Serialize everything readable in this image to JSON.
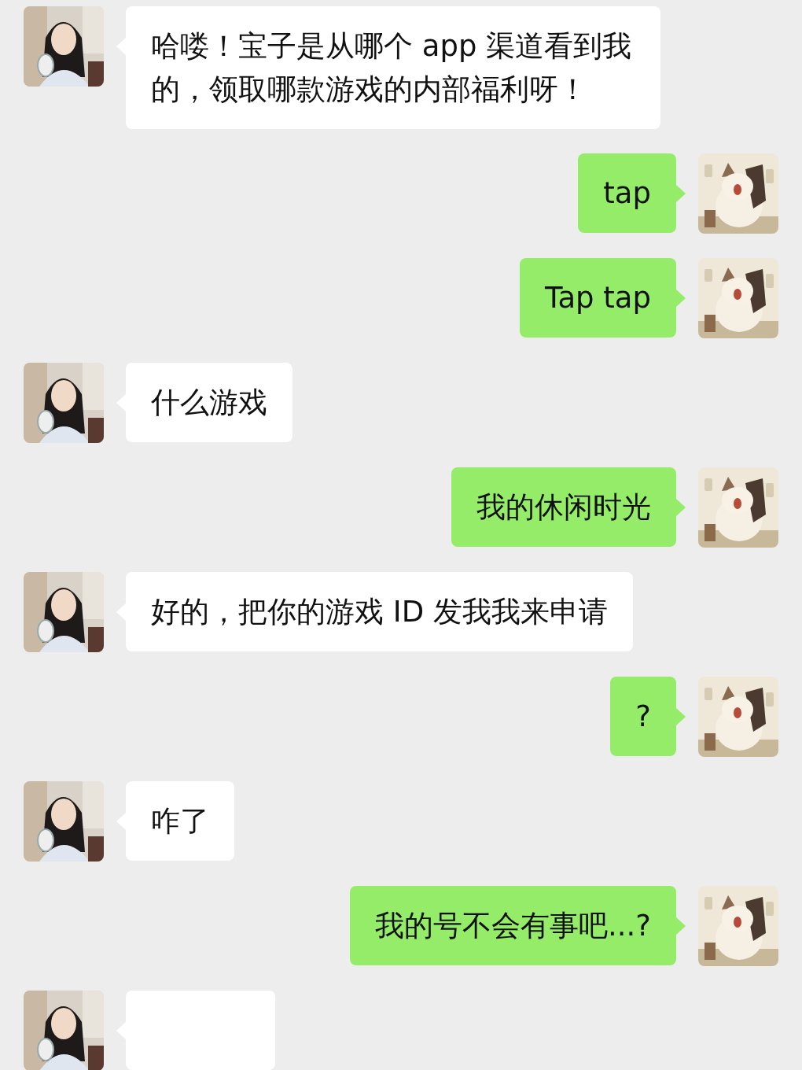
{
  "messages": [
    {
      "kind": "incoming",
      "text": "哈喽！宝子是从哪个 app 渠道看到我的，领取哪款游戏的内部福利呀！"
    },
    {
      "kind": "outgoing",
      "text": "tap"
    },
    {
      "kind": "outgoing",
      "text": "Tap tap"
    },
    {
      "kind": "incoming",
      "text": "什么游戏"
    },
    {
      "kind": "outgoing",
      "text": "我的休闲时光"
    },
    {
      "kind": "incoming",
      "text": "好的，把你的游戏 ID 发我我来申请"
    },
    {
      "kind": "outgoing",
      "text": "?"
    },
    {
      "kind": "incoming",
      "text": "咋了"
    },
    {
      "kind": "outgoing",
      "text": "我的号不会有事吧...?"
    },
    {
      "kind": "incoming"
    }
  ]
}
